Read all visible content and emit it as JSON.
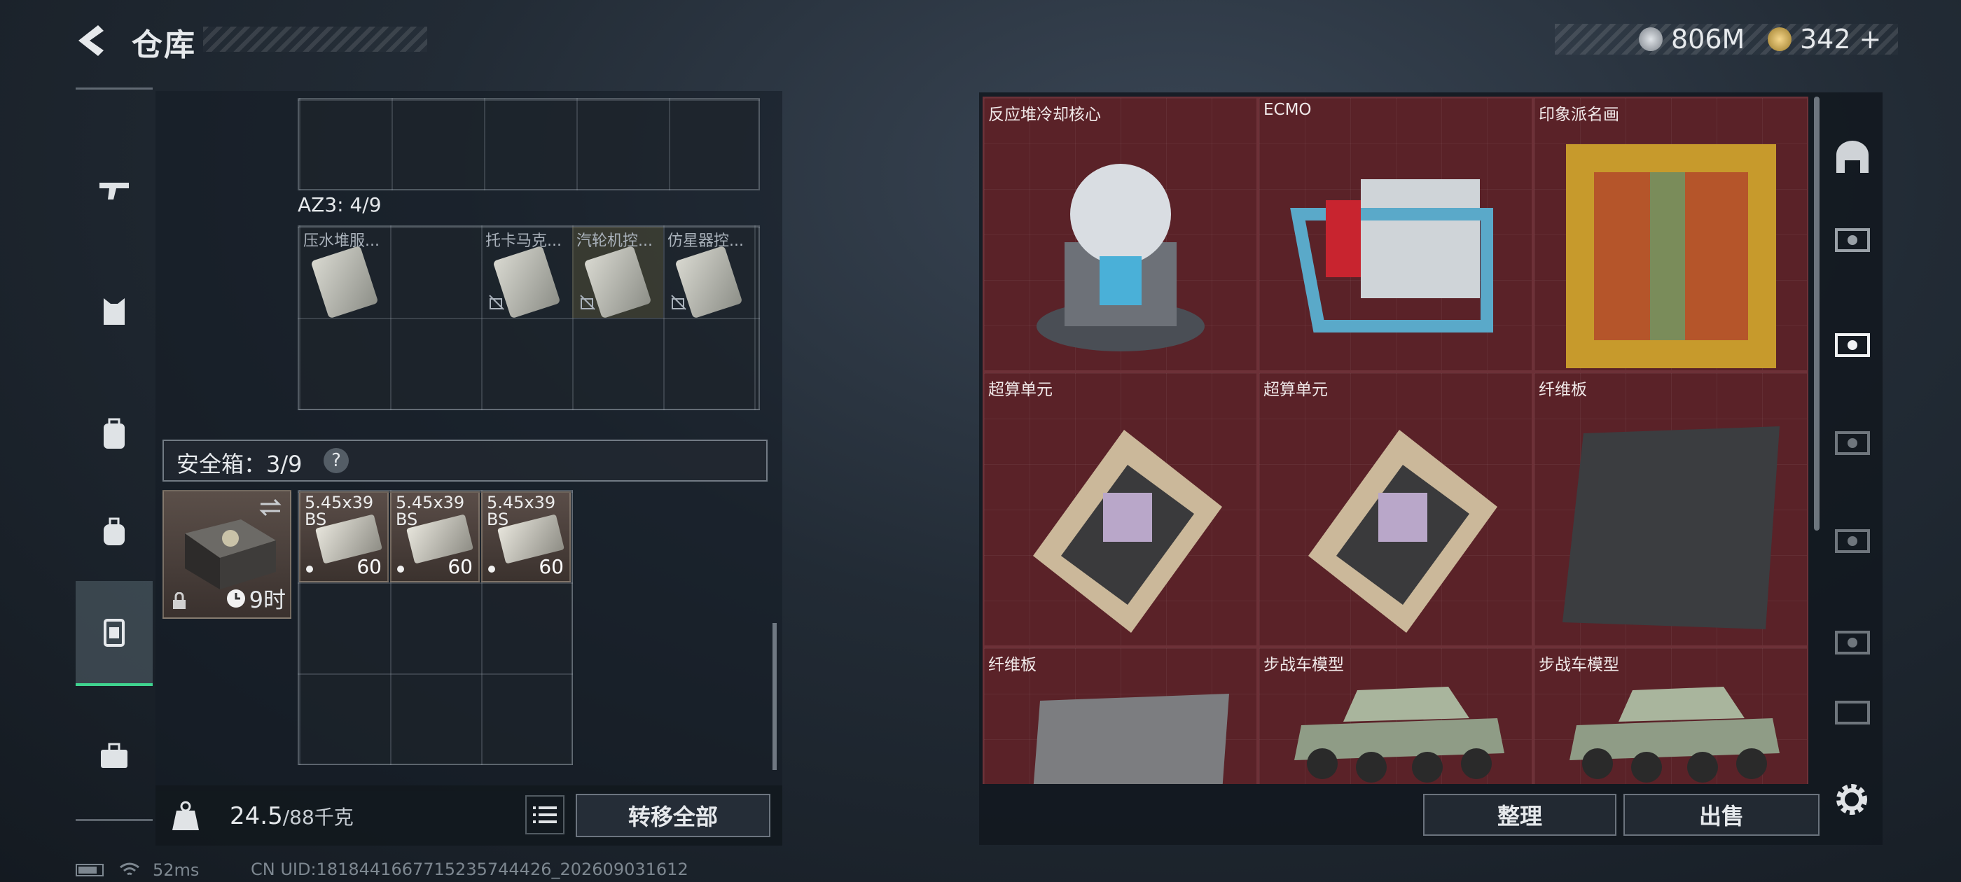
{
  "header": {
    "title": "仓库"
  },
  "currency": {
    "silver": "806M",
    "gold": "342",
    "gold_add": "+"
  },
  "backpack": {
    "az3_label": "AZ3: 4/9",
    "az3_items": [
      "压水堆服...",
      "托卡马克...",
      "汽轮机控...",
      "仿星器控..."
    ],
    "safe_label": "安全箱：3/9",
    "safe_help": "?",
    "safe_timer": "9时",
    "ammo": [
      {
        "name": "5.45x39 BS",
        "count": "60"
      },
      {
        "name": "5.45x39 BS",
        "count": "60"
      },
      {
        "name": "5.45x39 BS",
        "count": "60"
      }
    ],
    "weight_current": "24.5",
    "weight_max": "/88千克",
    "transfer_all": "转移全部"
  },
  "warehouse": {
    "items": [
      "反应堆冷却核心",
      "ECMO",
      "印象派名画",
      "超算单元",
      "超算单元",
      "纤维板",
      "纤维板",
      "步战车模型",
      "步战车模型"
    ],
    "sort_label": "整理",
    "sell_label": "出售"
  },
  "status": {
    "ping": "52ms",
    "uid": "CN UID:1818441667715235744426_202609031612"
  },
  "colors": {
    "active_green": "#3fd38f",
    "cell_red": "#5a2228"
  }
}
